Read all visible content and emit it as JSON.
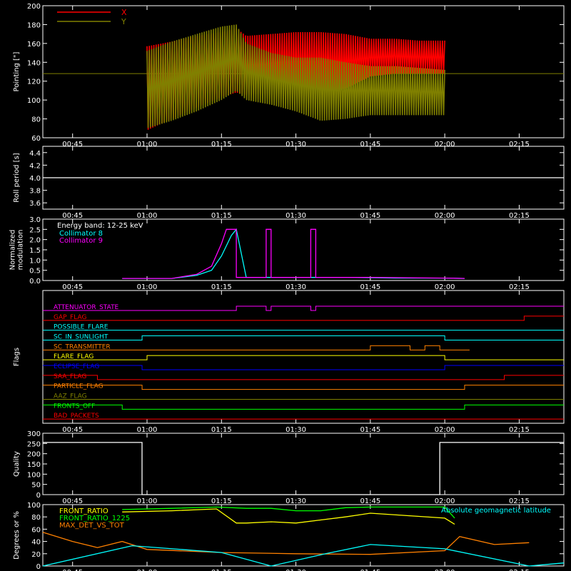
{
  "chart_data": [
    {
      "type": "line",
      "ylabel": "Pointing [\"]",
      "ylim": [
        60,
        200
      ],
      "yticks": [
        60,
        80,
        100,
        120,
        140,
        160,
        180,
        200
      ],
      "xlim_minutes": [
        40,
        100
      ],
      "xtick_labels": [
        "00:45",
        "01:00",
        "01:15",
        "01:30",
        "01:45",
        "02:00",
        "02:15"
      ],
      "legend": "top-left",
      "series": [
        {
          "name": "X",
          "color": "#ff0000",
          "x": [
            "01:00",
            "01:05",
            "01:10",
            "01:15",
            "01:18",
            "01:20",
            "01:25",
            "01:30",
            "01:35",
            "01:40",
            "01:45",
            "01:50",
            "01:55",
            "02:00"
          ],
          "y_upper": [
            157,
            162,
            168,
            172,
            176,
            168,
            170,
            172,
            172,
            170,
            165,
            165,
            163,
            163
          ],
          "y_lower": [
            68,
            80,
            92,
            103,
            108,
            105,
            108,
            110,
            110,
            112,
            125,
            128,
            128,
            128
          ]
        },
        {
          "name": "Y",
          "color": "#808000",
          "x": [
            "01:00",
            "01:05",
            "01:10",
            "01:15",
            "01:18",
            "01:20",
            "01:25",
            "01:30",
            "01:35",
            "01:40",
            "01:45",
            "01:50",
            "01:55",
            "02:00"
          ],
          "y_upper": [
            152,
            162,
            170,
            178,
            180,
            160,
            150,
            145,
            145,
            140,
            136,
            136,
            134,
            132
          ],
          "y_lower": [
            70,
            78,
            88,
            100,
            110,
            100,
            95,
            88,
            78,
            80,
            84,
            84,
            84,
            84
          ]
        }
      ],
      "reference_line": 128
    },
    {
      "type": "line",
      "ylabel": "Roll period [s]",
      "ylim": [
        3.5,
        4.5
      ],
      "yticks": [
        3.6,
        3.8,
        4.0,
        4.2,
        4.4
      ],
      "xtick_labels": [
        "00:45",
        "01:00",
        "01:15",
        "01:30",
        "01:45",
        "02:00",
        "02:15"
      ],
      "series": [
        {
          "name": "",
          "color": "#ffffff",
          "x": [
            "00:39",
            "01:00",
            "01:15",
            "01:30",
            "01:45",
            "02:00",
            "02:24"
          ],
          "y": [
            4.0,
            4.0,
            4.0,
            4.0,
            4.0,
            4.0,
            4.0
          ]
        }
      ]
    },
    {
      "type": "line",
      "ylabel": "Normalized\nmodulation",
      "ylim": [
        0,
        3.0
      ],
      "yticks": [
        0.0,
        0.5,
        1.0,
        1.5,
        2.0,
        2.5,
        3.0
      ],
      "xtick_labels": [
        "00:45",
        "01:00",
        "01:15",
        "01:30",
        "01:45",
        "02:00",
        "02:15"
      ],
      "annotation": "Energy band: 12-25 keV",
      "legend": "top-left",
      "series": [
        {
          "name": "Collimator 8",
          "color": "#00ffff",
          "x": [
            "00:55",
            "01:05",
            "01:10",
            "01:13",
            "01:15",
            "01:17",
            "01:18",
            "01:20",
            "01:30",
            "01:40",
            "01:50",
            "02:00",
            "02:04"
          ],
          "y": [
            0.1,
            0.1,
            0.25,
            0.5,
            1.2,
            2.2,
            2.5,
            0.15,
            0.15,
            0.15,
            0.12,
            0.12,
            0.1
          ]
        },
        {
          "name": "Collimator 9",
          "color": "#ff00ff",
          "x": [
            "00:55",
            "01:05",
            "01:10",
            "01:13",
            "01:15",
            "01:16",
            "01:18",
            "01:18",
            "01:24",
            "01:24",
            "01:25",
            "01:25",
            "01:33",
            "01:33",
            "01:34",
            "01:34",
            "01:45",
            "02:00",
            "02:04"
          ],
          "y": [
            0.1,
            0.1,
            0.3,
            0.7,
            1.8,
            2.5,
            2.5,
            0.15,
            0.15,
            2.5,
            2.5,
            0.15,
            0.15,
            2.5,
            2.5,
            0.15,
            0.15,
            0.12,
            0.1
          ]
        }
      ]
    },
    {
      "type": "line",
      "ylabel": "Flags",
      "xtick_labels": [
        "00:45",
        "01:00",
        "01:15",
        "01:30",
        "01:45",
        "02:00",
        "02:15"
      ],
      "flags": [
        {
          "name": "ATTENUATOR_STATE",
          "color": "#ff00ff",
          "segments": [
            [
              "00:39",
              "01:18",
              0
            ],
            [
              "01:18",
              "01:24",
              1
            ],
            [
              "01:24",
              "01:25",
              0
            ],
            [
              "01:25",
              "01:33",
              1
            ],
            [
              "01:33",
              "01:34",
              0
            ],
            [
              "01:34",
              "02:24",
              1
            ]
          ]
        },
        {
          "name": "GAP_FLAG",
          "color": "#ff0000",
          "segments": [
            [
              "00:39",
              "02:16",
              0
            ],
            [
              "02:16",
              "02:24",
              1
            ]
          ]
        },
        {
          "name": "POSSIBLE_FLARE",
          "color": "#00ffff",
          "segments": [
            [
              "00:39",
              "02:24",
              0
            ]
          ]
        },
        {
          "name": "SC_IN_SUNLIGHT",
          "color": "#00ffff",
          "segments": [
            [
              "00:39",
              "00:59",
              0
            ],
            [
              "00:59",
              "02:00",
              1
            ],
            [
              "02:00",
              "02:24",
              0
            ]
          ]
        },
        {
          "name": "SC_TRANSMITTER",
          "color": "#ff8000",
          "segments": [
            [
              "00:39",
              "01:45",
              0
            ],
            [
              "01:45",
              "01:53",
              1
            ],
            [
              "01:53",
              "01:56",
              0
            ],
            [
              "01:56",
              "01:59",
              1
            ],
            [
              "01:59",
              "02:05",
              0
            ]
          ]
        },
        {
          "name": "FLARE_FLAG",
          "color": "#ffff00",
          "segments": [
            [
              "00:39",
              "01:00",
              0
            ],
            [
              "01:00",
              "02:00",
              1
            ],
            [
              "02:00",
              "02:24",
              0
            ]
          ]
        },
        {
          "name": "ECLIPSE_FLAG",
          "color": "#0000ff",
          "segments": [
            [
              "00:39",
              "00:59",
              1
            ],
            [
              "00:59",
              "02:00",
              0
            ],
            [
              "02:00",
              "02:24",
              1
            ]
          ]
        },
        {
          "name": "SAA_FLAG",
          "color": "#ff0000",
          "segments": [
            [
              "00:39",
              "00:50",
              1
            ],
            [
              "00:50",
              "02:12",
              0
            ],
            [
              "02:12",
              "02:24",
              1
            ]
          ]
        },
        {
          "name": "PARTICLE_FLAG",
          "color": "#ff8000",
          "segments": [
            [
              "00:39",
              "00:59",
              1
            ],
            [
              "00:59",
              "02:04",
              0
            ],
            [
              "02:04",
              "02:24",
              1
            ]
          ]
        },
        {
          "name": "AAZ_FLAG",
          "color": "#808000",
          "segments": [
            [
              "00:39",
              "02:24",
              0
            ]
          ]
        },
        {
          "name": "FRONTS_OFF",
          "color": "#00ff00",
          "segments": [
            [
              "00:39",
              "00:55",
              1
            ],
            [
              "00:55",
              "02:04",
              0
            ],
            [
              "02:04",
              "02:24",
              1
            ]
          ]
        },
        {
          "name": "BAD_PACKETS",
          "color": "#ff0000",
          "segments": [
            [
              "00:39",
              "02:24",
              0
            ]
          ]
        }
      ]
    },
    {
      "type": "line",
      "ylabel": "Quality",
      "ylim": [
        0,
        300
      ],
      "yticks": [
        0,
        50,
        100,
        150,
        200,
        250,
        300
      ],
      "xtick_labels": [
        "00:45",
        "01:00",
        "01:15",
        "01:30",
        "01:45",
        "02:00",
        "02:15"
      ],
      "series": [
        {
          "name": "",
          "color": "#ffffff",
          "x": [
            "00:39",
            "00:59",
            "00:59",
            "01:59",
            "01:59",
            "02:24"
          ],
          "y": [
            255,
            255,
            0,
            0,
            255,
            255
          ]
        }
      ]
    },
    {
      "type": "line",
      "ylabel": "Degrees or %",
      "ylim": [
        0,
        100
      ],
      "yticks": [
        0,
        20,
        40,
        60,
        80,
        100
      ],
      "xtick_labels": [
        "00:45",
        "01:00",
        "01:15",
        "01:30",
        "01:45",
        "02:00",
        "02:15"
      ],
      "legend": "top-left",
      "series": [
        {
          "name": "FRONT_RATIO",
          "color": "#ffff00",
          "x": [
            "00:55",
            "01:05",
            "01:14",
            "01:18",
            "01:20",
            "01:25",
            "01:30",
            "01:35",
            "01:40",
            "01:45",
            "02:00",
            "02:02"
          ],
          "y": [
            88,
            90,
            93,
            70,
            70,
            72,
            70,
            75,
            80,
            86,
            78,
            68
          ]
        },
        {
          "name": "FRONT_RATIO_1225",
          "color": "#00ff00",
          "x": [
            "00:55",
            "01:05",
            "01:14",
            "01:20",
            "01:25",
            "01:30",
            "01:35",
            "01:40",
            "01:45",
            "02:00",
            "02:02"
          ],
          "y": [
            92,
            94,
            96,
            94,
            94,
            90,
            90,
            95,
            96,
            96,
            78
          ]
        },
        {
          "name": "MAX_DET_VS_TOT",
          "color": "#ff8000",
          "x": [
            "00:39",
            "00:45",
            "00:50",
            "00:55",
            "01:00",
            "01:15",
            "01:30",
            "01:45",
            "02:00",
            "02:03",
            "02:10",
            "02:17"
          ],
          "y": [
            55,
            40,
            30,
            40,
            27,
            22,
            20,
            19,
            25,
            48,
            35,
            38
          ]
        },
        {
          "name": "Absolute geomagnetic latitude",
          "color": "#00ffff",
          "x": [
            "00:39",
            "00:57",
            "01:15",
            "01:25",
            "01:36",
            "01:45",
            "02:00",
            "02:17",
            "02:24"
          ],
          "y": [
            0,
            33,
            22,
            0,
            20,
            35,
            28,
            0,
            5
          ]
        }
      ]
    }
  ]
}
